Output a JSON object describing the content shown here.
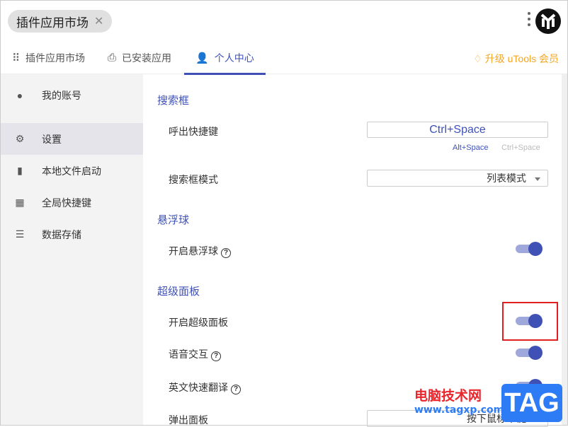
{
  "header": {
    "chip_label": "插件应用市场",
    "logo_text": "uTools"
  },
  "tabs": [
    {
      "label": "插件应用市场",
      "icon": "grid-icon"
    },
    {
      "label": "已安装应用",
      "icon": "download-icon"
    },
    {
      "label": "个人中心",
      "icon": "user-gear-icon"
    }
  ],
  "upgrade": "升级 uTools 会员",
  "sidebar": [
    {
      "label": "我的账号",
      "icon": "account-icon"
    },
    {
      "label": "设置",
      "icon": "gear-icon"
    },
    {
      "label": "本地文件启动",
      "icon": "file-icon"
    },
    {
      "label": "全局快捷键",
      "icon": "keyboard-icon"
    },
    {
      "label": "数据存储",
      "icon": "storage-icon"
    }
  ],
  "settings": {
    "search_section": "搜索框",
    "hotkey_label": "呼出快捷键",
    "hotkey_value": "Ctrl+Space",
    "hotkey_opt1": "Alt+Space",
    "hotkey_opt2": "Ctrl+Space",
    "mode_label": "搜索框模式",
    "mode_value": "列表模式",
    "float_section": "悬浮球",
    "float_label": "开启悬浮球",
    "panel_section": "超级面板",
    "panel_label": "开启超级面板",
    "voice_label": "语音交互",
    "translate_label": "英文快速翻译",
    "popup_label": "弹出面板",
    "popup_value": "按下鼠标中键"
  },
  "watermark": {
    "site": "电脑技术网",
    "url": "www.tagxp.com",
    "tag": "TAG"
  },
  "colors": {
    "accent": "#3f51b5",
    "upgrade": "#f5a623",
    "highlight": "#e02020"
  }
}
